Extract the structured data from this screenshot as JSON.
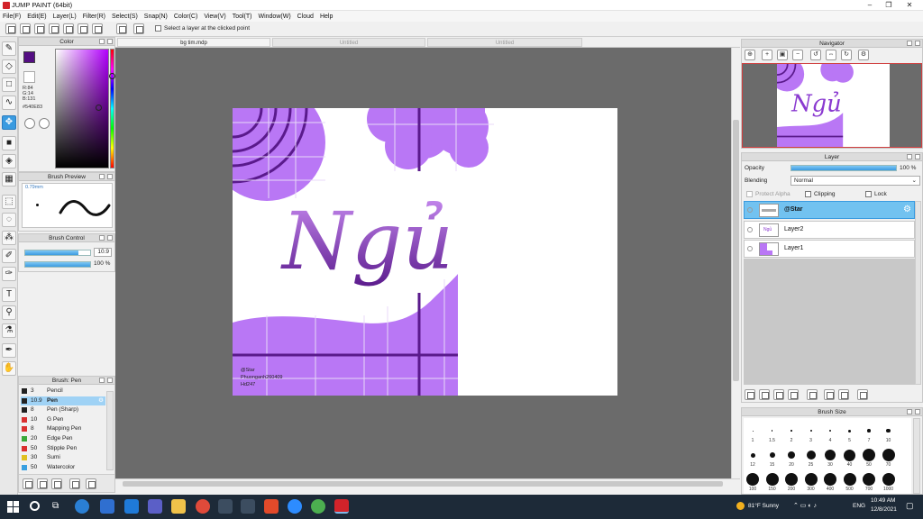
{
  "window": {
    "title": "JUMP PAINT (64bit)",
    "min": "–",
    "max": "❐",
    "close": "✕"
  },
  "menu": [
    "File(F)",
    "Edit(E)",
    "Layer(L)",
    "Filter(R)",
    "Select(S)",
    "Snap(N)",
    "Color(C)",
    "View(V)",
    "Tool(T)",
    "Window(W)",
    "Cloud",
    "Help"
  ],
  "toolbar": {
    "checkbox_label": "Select a layer at the clicked point"
  },
  "color_panel": {
    "title": "Color",
    "r": "R:84",
    "g": "G:14",
    "b": "B:131",
    "hex": "#540E83",
    "main_color": "#540e83",
    "sub_color": "#d93030"
  },
  "brush_preview": {
    "title": "Brush Preview",
    "size_label": "0.79mm"
  },
  "brush_control": {
    "title": "Brush Control",
    "size_value": "10.9",
    "opacity_value": "100 %",
    "size_fraction": 0.82,
    "opacity_fraction": 1.0
  },
  "brush_list": {
    "title": "Brush: Pen",
    "items": [
      {
        "size": "3",
        "name": "Pencil",
        "color": "#222222"
      },
      {
        "size": "10.9",
        "name": "Pen",
        "color": "#222222"
      },
      {
        "size": "8",
        "name": "Pen (Sharp)",
        "color": "#222222"
      },
      {
        "size": "10",
        "name": "G Pen",
        "color": "#d93030"
      },
      {
        "size": "8",
        "name": "Mapping Pen",
        "color": "#d93030"
      },
      {
        "size": "20",
        "name": "Edge Pen",
        "color": "#3aa83a"
      },
      {
        "size": "50",
        "name": "Stipple Pen",
        "color": "#d93030"
      },
      {
        "size": "30",
        "name": "Sumi",
        "color": "#e0c020"
      },
      {
        "size": "50",
        "name": "Watercolor",
        "color": "#3aa0e0"
      }
    ]
  },
  "tabs": [
    "bg tim.mdp",
    "Untitled",
    "Untitled"
  ],
  "canvas": {
    "title_text": "Ngủ",
    "watermark": [
      "@Star",
      "Phuonganh260409",
      "Hd247"
    ],
    "accent": "#b977f5",
    "line": "#5a1a8c"
  },
  "navigator": {
    "title": "Navigator"
  },
  "layer_panel": {
    "title": "Layer",
    "opacity_label": "Opacity",
    "opacity_value": "100 %",
    "blending_label": "Blending",
    "blending_value": "Normal",
    "protect_alpha": "Protect Alpha",
    "clipping": "Clipping",
    "lock": "Lock",
    "layers": [
      {
        "name": "@Star"
      },
      {
        "name": "Layer2"
      },
      {
        "name": "Layer1"
      }
    ]
  },
  "brush_size": {
    "title": "Brush Size",
    "sizes": [
      "1",
      "1.5",
      "2",
      "3",
      "4",
      "5",
      "7",
      "10",
      "12",
      "15",
      "20",
      "25",
      "30",
      "40",
      "50",
      "70",
      "100",
      "150",
      "200",
      "300",
      "400",
      "500",
      "700",
      "1000"
    ]
  },
  "taskbar": {
    "weather": "81°F  Sunny",
    "lang": "ENG",
    "time": "10:49 AM",
    "date": "12/8/2021"
  }
}
